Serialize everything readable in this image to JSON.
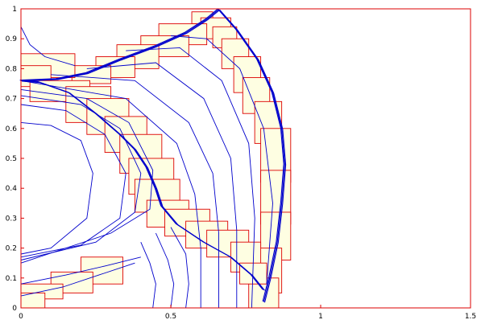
{
  "chart_data": {
    "type": "contour",
    "xlim": [
      0,
      1.5
    ],
    "ylim": [
      0,
      1
    ],
    "xticks": [
      {
        "value": 0,
        "label": "0"
      },
      {
        "value": 0.5,
        "label": "0.5"
      },
      {
        "value": 1,
        "label": "1"
      },
      {
        "value": 1.5,
        "label": "1.5"
      }
    ],
    "yticks": [
      {
        "value": 0,
        "label": "0"
      },
      {
        "value": 0.1,
        "label": "0.1"
      },
      {
        "value": 0.2,
        "label": "0.2"
      },
      {
        "value": 0.3,
        "label": "0.3"
      },
      {
        "value": 0.4,
        "label": "0.4"
      },
      {
        "value": 0.5,
        "label": "0.5"
      },
      {
        "value": 0.6,
        "label": "0.6"
      },
      {
        "value": 0.7,
        "label": "0.7"
      },
      {
        "value": 0.8,
        "label": "0.8"
      },
      {
        "value": 0.9,
        "label": "0.9"
      },
      {
        "value": 1,
        "label": "1"
      }
    ],
    "colors": {
      "frame": "#dd0000",
      "contour": "#0000cc",
      "patch_fill": "#fefee2",
      "patch_edge": "#dd0000"
    },
    "refinement_patches": [
      [
        0.57,
        0.95,
        0.64,
        0.99
      ],
      [
        0.6,
        0.9,
        0.7,
        0.97
      ],
      [
        0.64,
        0.87,
        0.72,
        0.94
      ],
      [
        0.67,
        0.8,
        0.76,
        0.9
      ],
      [
        0.71,
        0.72,
        0.8,
        0.84
      ],
      [
        0.74,
        0.65,
        0.83,
        0.77
      ],
      [
        0.78,
        0.55,
        0.87,
        0.69
      ],
      [
        0.8,
        0.42,
        0.9,
        0.6
      ],
      [
        0.8,
        0.28,
        0.9,
        0.46
      ],
      [
        0.8,
        0.16,
        0.9,
        0.32
      ],
      [
        0.78,
        0.05,
        0.87,
        0.2
      ],
      [
        0.76,
        0.0,
        0.86,
        0.1
      ],
      [
        0.46,
        0.88,
        0.62,
        0.95
      ],
      [
        0.4,
        0.84,
        0.56,
        0.91
      ],
      [
        0.32,
        0.8,
        0.46,
        0.88
      ],
      [
        0.25,
        0.77,
        0.38,
        0.84
      ],
      [
        0.17,
        0.75,
        0.3,
        0.81
      ],
      [
        0.0,
        0.77,
        0.18,
        0.85
      ],
      [
        0.0,
        0.74,
        0.1,
        0.81
      ],
      [
        0.03,
        0.69,
        0.23,
        0.76
      ],
      [
        0.15,
        0.62,
        0.3,
        0.74
      ],
      [
        0.22,
        0.58,
        0.36,
        0.7
      ],
      [
        0.28,
        0.52,
        0.42,
        0.64
      ],
      [
        0.33,
        0.45,
        0.47,
        0.58
      ],
      [
        0.36,
        0.38,
        0.51,
        0.5
      ],
      [
        0.38,
        0.32,
        0.53,
        0.43
      ],
      [
        0.42,
        0.27,
        0.56,
        0.36
      ],
      [
        0.48,
        0.24,
        0.63,
        0.33
      ],
      [
        0.55,
        0.2,
        0.69,
        0.29
      ],
      [
        0.62,
        0.17,
        0.76,
        0.26
      ],
      [
        0.7,
        0.12,
        0.8,
        0.22
      ],
      [
        0.73,
        0.08,
        0.82,
        0.15
      ],
      [
        0.2,
        0.08,
        0.34,
        0.17
      ],
      [
        0.1,
        0.05,
        0.24,
        0.12
      ],
      [
        0.0,
        0.03,
        0.14,
        0.08
      ],
      [
        0.0,
        0.0,
        0.08,
        0.05
      ]
    ],
    "shock_paths": [
      [
        [
          0.0,
          0.76
        ],
        [
          0.12,
          0.765
        ],
        [
          0.22,
          0.785
        ],
        [
          0.33,
          0.83
        ],
        [
          0.45,
          0.875
        ],
        [
          0.55,
          0.92
        ],
        [
          0.62,
          0.965
        ],
        [
          0.66,
          0.998
        ]
      ],
      [
        [
          0.66,
          0.998
        ],
        [
          0.72,
          0.93
        ],
        [
          0.79,
          0.83
        ],
        [
          0.84,
          0.72
        ],
        [
          0.87,
          0.6
        ],
        [
          0.88,
          0.48
        ],
        [
          0.87,
          0.35
        ],
        [
          0.855,
          0.22
        ],
        [
          0.83,
          0.1
        ],
        [
          0.81,
          0.02
        ]
      ],
      [
        [
          0.81,
          0.06
        ],
        [
          0.77,
          0.11
        ],
        [
          0.7,
          0.17
        ],
        [
          0.61,
          0.22
        ],
        [
          0.52,
          0.28
        ],
        [
          0.47,
          0.34
        ],
        [
          0.45,
          0.4
        ],
        [
          0.42,
          0.47
        ],
        [
          0.38,
          0.53
        ],
        [
          0.33,
          0.58
        ],
        [
          0.25,
          0.65
        ],
        [
          0.16,
          0.72
        ],
        [
          0.06,
          0.755
        ],
        [
          0.0,
          0.76
        ]
      ]
    ],
    "contour_paths": [
      [
        [
          0.0,
          0.76
        ],
        [
          0.35,
          0.7
        ],
        [
          0.52,
          0.55
        ],
        [
          0.58,
          0.38
        ],
        [
          0.6,
          0.2
        ],
        [
          0.6,
          0.0
        ]
      ],
      [
        [
          0.1,
          0.78
        ],
        [
          0.38,
          0.76
        ],
        [
          0.56,
          0.62
        ],
        [
          0.64,
          0.45
        ],
        [
          0.66,
          0.25
        ],
        [
          0.66,
          0.0
        ]
      ],
      [
        [
          0.22,
          0.8
        ],
        [
          0.45,
          0.82
        ],
        [
          0.61,
          0.7
        ],
        [
          0.7,
          0.5
        ],
        [
          0.72,
          0.26
        ],
        [
          0.72,
          0.0
        ]
      ],
      [
        [
          0.35,
          0.86
        ],
        [
          0.53,
          0.87
        ],
        [
          0.67,
          0.76
        ],
        [
          0.76,
          0.55
        ],
        [
          0.78,
          0.3
        ],
        [
          0.77,
          0.0
        ]
      ],
      [
        [
          0.5,
          0.91
        ],
        [
          0.62,
          0.9
        ],
        [
          0.73,
          0.8
        ],
        [
          0.81,
          0.6
        ],
        [
          0.84,
          0.35
        ],
        [
          0.82,
          0.08
        ]
      ],
      [
        [
          0.0,
          0.62
        ],
        [
          0.1,
          0.61
        ],
        [
          0.2,
          0.56
        ],
        [
          0.24,
          0.45
        ],
        [
          0.22,
          0.3
        ],
        [
          0.1,
          0.2
        ],
        [
          0.0,
          0.18
        ]
      ],
      [
        [
          0.0,
          0.68
        ],
        [
          0.15,
          0.66
        ],
        [
          0.28,
          0.58
        ],
        [
          0.35,
          0.45
        ],
        [
          0.33,
          0.3
        ],
        [
          0.2,
          0.21
        ],
        [
          0.0,
          0.17
        ]
      ],
      [
        [
          0.0,
          0.71
        ],
        [
          0.2,
          0.68
        ],
        [
          0.33,
          0.6
        ],
        [
          0.4,
          0.45
        ],
        [
          0.38,
          0.32
        ],
        [
          0.25,
          0.22
        ],
        [
          0.0,
          0.16
        ]
      ],
      [
        [
          0.0,
          0.73
        ],
        [
          0.22,
          0.7
        ],
        [
          0.36,
          0.62
        ],
        [
          0.44,
          0.46
        ],
        [
          0.43,
          0.33
        ],
        [
          0.3,
          0.25
        ],
        [
          0.0,
          0.15
        ]
      ],
      [
        [
          0.0,
          0.08
        ],
        [
          0.15,
          0.11
        ],
        [
          0.28,
          0.14
        ],
        [
          0.4,
          0.17
        ]
      ],
      [
        [
          0.0,
          0.04
        ],
        [
          0.14,
          0.07
        ],
        [
          0.26,
          0.11
        ],
        [
          0.38,
          0.15
        ]
      ],
      [
        [
          0.0,
          0.94
        ],
        [
          0.03,
          0.88
        ],
        [
          0.08,
          0.84
        ],
        [
          0.18,
          0.81
        ]
      ],
      [
        [
          0.4,
          0.22
        ],
        [
          0.43,
          0.15
        ],
        [
          0.45,
          0.08
        ],
        [
          0.44,
          0.0
        ]
      ],
      [
        [
          0.45,
          0.25
        ],
        [
          0.49,
          0.16
        ],
        [
          0.51,
          0.08
        ],
        [
          0.5,
          0.0
        ]
      ],
      [
        [
          0.5,
          0.27
        ],
        [
          0.55,
          0.18
        ],
        [
          0.56,
          0.08
        ],
        [
          0.55,
          0.0
        ]
      ]
    ]
  }
}
